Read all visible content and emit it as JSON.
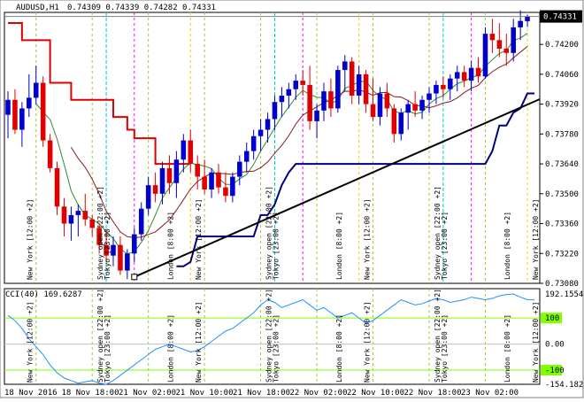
{
  "header": {
    "symbol": "AUDUSD,H1",
    "ohlc": "0.74309 0.74339 0.74282 0.74331"
  },
  "indicator": {
    "label": "CCI(40) 169.6287",
    "ticks": [
      {
        "value": 192.1554,
        "label": "192.1554"
      },
      {
        "value": 100,
        "label": "100",
        "boxed": true
      },
      {
        "value": 0,
        "label": "0.00"
      },
      {
        "value": -100,
        "label": "-100",
        "boxed": true
      },
      {
        "value": -154.1828,
        "label": "-154.1828"
      }
    ]
  },
  "colors": {
    "background": "#ffffff",
    "bull_candle": "#0000cc",
    "bear_candle": "#e00000",
    "supertrend_red": "#dd0000",
    "supertrend_blue": "#000080",
    "ma_fast": "#2e8b2e",
    "ma_slow": "#8b1a1a",
    "trendline": "#000000",
    "cci_line": "#1e90ff",
    "cci_level": "#7fff00",
    "price_box": "#000000"
  },
  "chart_data": {
    "type": "candlestick",
    "timeframe": "H1",
    "ylim": [
      0.7308,
      0.7435
    ],
    "y_ticks": [
      0.74331,
      0.742,
      0.7406,
      0.7392,
      0.7378,
      0.7364,
      0.735,
      0.7336,
      0.7322,
      0.7308
    ],
    "current_price": 0.74331,
    "x_tick_labels": [
      "18 Nov 2016",
      "18 Nov 18:00",
      "21 Nov 02:00",
      "21 Nov 10:00",
      "21 Nov 18:00",
      "22 Nov 02:00",
      "22 Nov 10:00",
      "22 Nov 18:00",
      "23 Nov 02:00"
    ],
    "session_labels": [
      {
        "text": "New York [12:00 +2]",
        "bar": 4
      },
      {
        "text": "Sydney open [22:00 +2]",
        "bar": 14
      },
      {
        "text": "Tokyo [23:00 +2]",
        "bar": 15
      },
      {
        "text": "London [8:00 +2]",
        "bar": 24
      },
      {
        "text": "New York [12:00 +2]",
        "bar": 28
      },
      {
        "text": "Sydney open [22:00 +2]",
        "bar": 38
      },
      {
        "text": "Tokyo [23:00 +2]",
        "bar": 39
      },
      {
        "text": "London [8:00 +2]",
        "bar": 48
      },
      {
        "text": "New York [12:00 +2]",
        "bar": 52
      },
      {
        "text": "Sydney open [22:00 +2]",
        "bar": 62
      },
      {
        "text": "Tokyo [23:00 +2]",
        "bar": 63
      },
      {
        "text": "London [8:00 +2]",
        "bar": 72
      },
      {
        "text": "New York [12:00 +2]",
        "bar": 76
      }
    ],
    "candles": [
      {
        "o": 0.7387,
        "h": 0.7398,
        "l": 0.7376,
        "c": 0.7394
      },
      {
        "o": 0.7394,
        "h": 0.7399,
        "l": 0.7378,
        "c": 0.738
      },
      {
        "o": 0.738,
        "h": 0.7393,
        "l": 0.7372,
        "c": 0.739
      },
      {
        "o": 0.739,
        "h": 0.7406,
        "l": 0.7386,
        "c": 0.7395
      },
      {
        "o": 0.7395,
        "h": 0.741,
        "l": 0.7392,
        "c": 0.7402
      },
      {
        "o": 0.7402,
        "h": 0.7405,
        "l": 0.7372,
        "c": 0.7375
      },
      {
        "o": 0.7375,
        "h": 0.7378,
        "l": 0.736,
        "c": 0.7362
      },
      {
        "o": 0.7362,
        "h": 0.7365,
        "l": 0.734,
        "c": 0.7344
      },
      {
        "o": 0.7344,
        "h": 0.7348,
        "l": 0.733,
        "c": 0.7336
      },
      {
        "o": 0.7336,
        "h": 0.7344,
        "l": 0.7328,
        "c": 0.734
      },
      {
        "o": 0.734,
        "h": 0.7345,
        "l": 0.733,
        "c": 0.7342
      },
      {
        "o": 0.7342,
        "h": 0.735,
        "l": 0.7335,
        "c": 0.7338
      },
      {
        "o": 0.7338,
        "h": 0.734,
        "l": 0.733,
        "c": 0.7334
      },
      {
        "o": 0.7334,
        "h": 0.7336,
        "l": 0.7322,
        "c": 0.7326
      },
      {
        "o": 0.7326,
        "h": 0.7332,
        "l": 0.7318,
        "c": 0.7321
      },
      {
        "o": 0.7321,
        "h": 0.733,
        "l": 0.7316,
        "c": 0.7326
      },
      {
        "o": 0.7326,
        "h": 0.733,
        "l": 0.7312,
        "c": 0.7314
      },
      {
        "o": 0.7314,
        "h": 0.7324,
        "l": 0.731,
        "c": 0.7322
      },
      {
        "o": 0.7322,
        "h": 0.7334,
        "l": 0.7318,
        "c": 0.7331
      },
      {
        "o": 0.7331,
        "h": 0.7346,
        "l": 0.7328,
        "c": 0.7343
      },
      {
        "o": 0.7343,
        "h": 0.7358,
        "l": 0.734,
        "c": 0.7354
      },
      {
        "o": 0.7354,
        "h": 0.736,
        "l": 0.7346,
        "c": 0.735
      },
      {
        "o": 0.735,
        "h": 0.7365,
        "l": 0.7345,
        "c": 0.7362
      },
      {
        "o": 0.7362,
        "h": 0.7368,
        "l": 0.735,
        "c": 0.7355
      },
      {
        "o": 0.7355,
        "h": 0.737,
        "l": 0.7348,
        "c": 0.7366
      },
      {
        "o": 0.7366,
        "h": 0.7378,
        "l": 0.736,
        "c": 0.7375
      },
      {
        "o": 0.7375,
        "h": 0.738,
        "l": 0.736,
        "c": 0.7364
      },
      {
        "o": 0.7364,
        "h": 0.7368,
        "l": 0.7352,
        "c": 0.7358
      },
      {
        "o": 0.7358,
        "h": 0.7366,
        "l": 0.735,
        "c": 0.7352
      },
      {
        "o": 0.7352,
        "h": 0.7362,
        "l": 0.7348,
        "c": 0.736
      },
      {
        "o": 0.736,
        "h": 0.7364,
        "l": 0.735,
        "c": 0.7353
      },
      {
        "o": 0.7353,
        "h": 0.736,
        "l": 0.7346,
        "c": 0.7349
      },
      {
        "o": 0.7349,
        "h": 0.736,
        "l": 0.7346,
        "c": 0.7358
      },
      {
        "o": 0.7358,
        "h": 0.7368,
        "l": 0.7354,
        "c": 0.7365
      },
      {
        "o": 0.7365,
        "h": 0.7374,
        "l": 0.736,
        "c": 0.737
      },
      {
        "o": 0.737,
        "h": 0.738,
        "l": 0.7366,
        "c": 0.7377
      },
      {
        "o": 0.7377,
        "h": 0.7385,
        "l": 0.737,
        "c": 0.738
      },
      {
        "o": 0.738,
        "h": 0.7388,
        "l": 0.7374,
        "c": 0.7385
      },
      {
        "o": 0.7385,
        "h": 0.7396,
        "l": 0.738,
        "c": 0.7393
      },
      {
        "o": 0.7393,
        "h": 0.74,
        "l": 0.7386,
        "c": 0.7396
      },
      {
        "o": 0.7396,
        "h": 0.7402,
        "l": 0.739,
        "c": 0.7399
      },
      {
        "o": 0.7399,
        "h": 0.7406,
        "l": 0.7394,
        "c": 0.7403
      },
      {
        "o": 0.7403,
        "h": 0.7408,
        "l": 0.7396,
        "c": 0.7401
      },
      {
        "o": 0.7401,
        "h": 0.741,
        "l": 0.738,
        "c": 0.7384
      },
      {
        "o": 0.7384,
        "h": 0.7392,
        "l": 0.7376,
        "c": 0.7389
      },
      {
        "o": 0.7389,
        "h": 0.7402,
        "l": 0.7384,
        "c": 0.7398
      },
      {
        "o": 0.7398,
        "h": 0.7404,
        "l": 0.7386,
        "c": 0.739
      },
      {
        "o": 0.739,
        "h": 0.741,
        "l": 0.7388,
        "c": 0.7408
      },
      {
        "o": 0.7408,
        "h": 0.7415,
        "l": 0.7398,
        "c": 0.7412
      },
      {
        "o": 0.7412,
        "h": 0.7414,
        "l": 0.7392,
        "c": 0.7396
      },
      {
        "o": 0.7396,
        "h": 0.741,
        "l": 0.7392,
        "c": 0.7406
      },
      {
        "o": 0.7406,
        "h": 0.7408,
        "l": 0.7388,
        "c": 0.7392
      },
      {
        "o": 0.7392,
        "h": 0.7404,
        "l": 0.7384,
        "c": 0.7386
      },
      {
        "o": 0.7386,
        "h": 0.74,
        "l": 0.7382,
        "c": 0.7397
      },
      {
        "o": 0.7397,
        "h": 0.7402,
        "l": 0.7386,
        "c": 0.739
      },
      {
        "o": 0.739,
        "h": 0.7392,
        "l": 0.7374,
        "c": 0.7378
      },
      {
        "o": 0.7378,
        "h": 0.739,
        "l": 0.7375,
        "c": 0.7388
      },
      {
        "o": 0.7388,
        "h": 0.7394,
        "l": 0.738,
        "c": 0.7392
      },
      {
        "o": 0.7392,
        "h": 0.7398,
        "l": 0.7386,
        "c": 0.7389
      },
      {
        "o": 0.7389,
        "h": 0.7396,
        "l": 0.7385,
        "c": 0.7394
      },
      {
        "o": 0.7394,
        "h": 0.74,
        "l": 0.7388,
        "c": 0.7397
      },
      {
        "o": 0.7397,
        "h": 0.7403,
        "l": 0.7392,
        "c": 0.7401
      },
      {
        "o": 0.7401,
        "h": 0.7405,
        "l": 0.7395,
        "c": 0.7399
      },
      {
        "o": 0.7399,
        "h": 0.7406,
        "l": 0.7394,
        "c": 0.7404
      },
      {
        "o": 0.7404,
        "h": 0.741,
        "l": 0.7398,
        "c": 0.7407
      },
      {
        "o": 0.7407,
        "h": 0.741,
        "l": 0.74,
        "c": 0.7403
      },
      {
        "o": 0.7403,
        "h": 0.7412,
        "l": 0.7398,
        "c": 0.7409
      },
      {
        "o": 0.7409,
        "h": 0.7414,
        "l": 0.7402,
        "c": 0.7405
      },
      {
        "o": 0.7405,
        "h": 0.7428,
        "l": 0.7404,
        "c": 0.7425
      },
      {
        "o": 0.7425,
        "h": 0.7432,
        "l": 0.7416,
        "c": 0.7422
      },
      {
        "o": 0.7422,
        "h": 0.743,
        "l": 0.7414,
        "c": 0.7418
      },
      {
        "o": 0.7418,
        "h": 0.7425,
        "l": 0.741,
        "c": 0.7416
      },
      {
        "o": 0.7416,
        "h": 0.7432,
        "l": 0.7412,
        "c": 0.7428
      },
      {
        "o": 0.7428,
        "h": 0.7436,
        "l": 0.7422,
        "c": 0.7431
      },
      {
        "o": 0.74309,
        "h": 0.74339,
        "l": 0.74282,
        "c": 0.74331
      }
    ],
    "supertrend_red": [
      0.743,
      0.743,
      0.7422,
      0.7422,
      0.7422,
      0.7422,
      0.7402,
      0.7402,
      0.7402,
      0.7394,
      0.7394,
      0.7394,
      0.7394,
      0.7394,
      0.7394,
      0.7386,
      0.7386,
      0.738,
      0.7376,
      0.7376,
      0.7376,
      0.7364,
      0.7364,
      0.7364,
      0.7364,
      0.7364,
      0.7364
    ],
    "supertrend_blue": [
      0.7316,
      0.7316,
      0.7318,
      0.733,
      0.733,
      0.733,
      0.733,
      0.733,
      0.733,
      0.733,
      0.733,
      0.733,
      0.734,
      0.734,
      0.7345,
      0.7354,
      0.736,
      0.7364,
      0.7364,
      0.7364,
      0.7364,
      0.7364,
      0.7364,
      0.7364,
      0.7364,
      0.7364,
      0.7364,
      0.7364,
      0.7364,
      0.7364,
      0.7364,
      0.7364,
      0.7364,
      0.7364,
      0.7364,
      0.7364,
      0.7364,
      0.7364,
      0.7364,
      0.7364,
      0.7364,
      0.7364,
      0.7364,
      0.7364,
      0.7364,
      0.737,
      0.7382,
      0.7382,
      0.7388,
      0.739,
      0.7397,
      0.7397
    ],
    "trendline": [
      {
        "bar": 18,
        "price": 0.7311
      },
      {
        "bar": 88,
        "price": 0.7412
      }
    ],
    "cci": [
      110,
      90,
      60,
      20,
      -10,
      -40,
      -80,
      -110,
      -130,
      -140,
      -150,
      -145,
      -140,
      -150,
      -154,
      -140,
      -120,
      -100,
      -80,
      -60,
      -40,
      -20,
      -10,
      0,
      -10,
      -20,
      -30,
      -25,
      -10,
      10,
      30,
      50,
      60,
      80,
      100,
      120,
      150,
      170,
      160,
      140,
      150,
      160,
      170,
      150,
      130,
      140,
      120,
      100,
      110,
      120,
      100,
      80,
      90,
      110,
      130,
      150,
      170,
      160,
      150,
      155,
      165,
      175,
      170,
      160,
      165,
      170,
      180,
      175,
      170,
      175,
      185,
      190,
      192,
      180,
      170,
      169.6287
    ]
  }
}
